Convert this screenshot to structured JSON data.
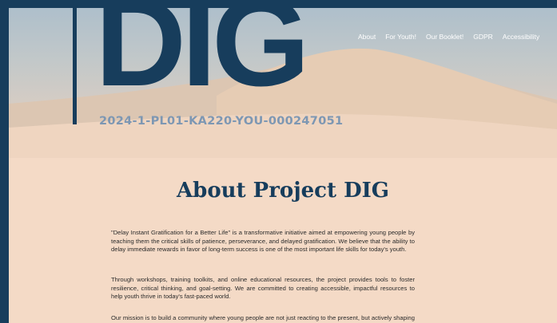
{
  "header": {
    "logo_text": "DIG",
    "project_code": "2024-1-PL01-KA220-YOU-000247051"
  },
  "nav": {
    "items": [
      "About",
      "For Youth!",
      "Our Booklet!",
      "GDPR",
      "Accessibility"
    ]
  },
  "main": {
    "title": "About Project DIG",
    "paragraphs": [
      "\"Delay Instant Gratification for a Better Life\" is a transformative initiative aimed at empowering young people by teaching them the critical skills of patience, perseverance, and delayed gratification. We believe that the ability to delay immediate rewards in favor of long-term success is one of the most important life skills for today's youth.",
      "Through workshops, training toolkits, and online educational resources, the project provides tools to foster resilience, critical thinking, and goal-setting. We are committed to creating accessible, impactful resources to help youth thrive in today's fast-paced world.",
      "Our mission is to build a community where young people are not just reacting to the present, but actively shaping their futures through disciplined action and focused determination."
    ]
  },
  "colors": {
    "frame": "#173d5c",
    "brand": "#173d5c",
    "code": "#7d97b3",
    "background": "#f4dac6"
  }
}
